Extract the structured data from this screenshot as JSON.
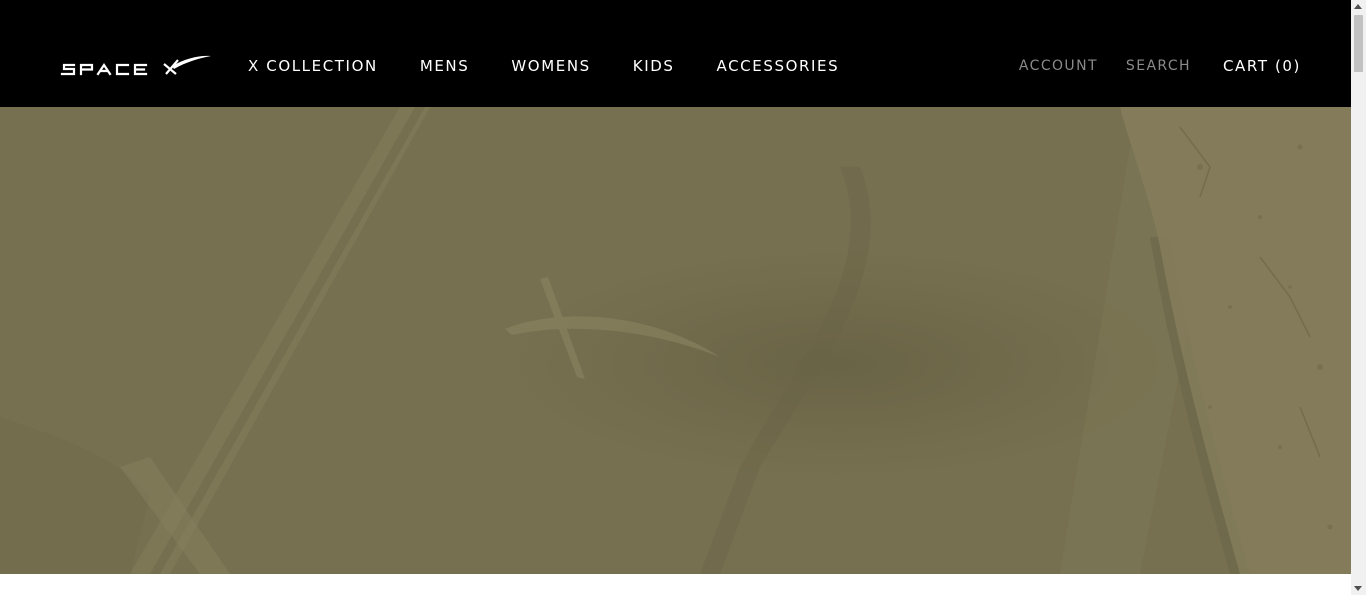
{
  "header": {
    "logo_text": "SPACEX",
    "nav": [
      {
        "label": "X COLLECTION"
      },
      {
        "label": "MENS"
      },
      {
        "label": "WOMENS"
      },
      {
        "label": "KIDS"
      },
      {
        "label": "ACCESSORIES"
      }
    ],
    "account_label": "ACCOUNT",
    "search_label": "SEARCH",
    "cart_label": "CART (0)"
  },
  "colors": {
    "header_bg": "#000000",
    "hero_tint": "#777050",
    "nav_text": "#ffffff",
    "muted_text": "#8a8a8a"
  }
}
